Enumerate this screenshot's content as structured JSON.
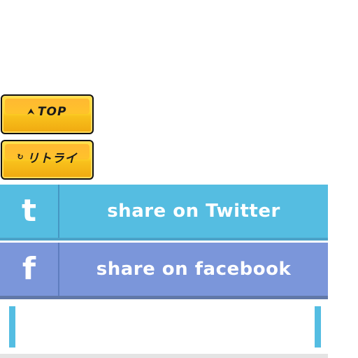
{
  "buttons": {
    "top": {
      "label": "TOP",
      "icon": "up-arrow-icon"
    },
    "retry": {
      "label": "リトライ",
      "icon": "retry-icon"
    }
  },
  "share": {
    "twitter": {
      "label": "share on Twitter",
      "icon_glyph": "t",
      "color": "#55bde1"
    },
    "facebook": {
      "label": "share on facebook",
      "icon_glyph": "f",
      "color": "#7b96da"
    }
  },
  "colors": {
    "button_yellow": "#ffd52a",
    "button_orange": "#f0a910",
    "accent_blue": "#54bde2"
  }
}
